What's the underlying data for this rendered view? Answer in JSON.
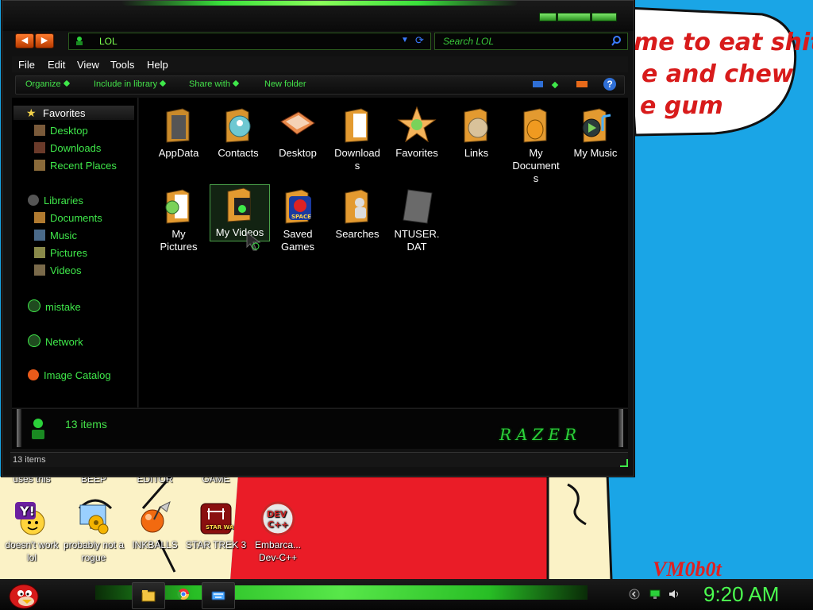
{
  "desktop": {
    "bubble_lines": [
      "me to eat shit",
      "e and chew",
      "e gum"
    ],
    "watermark": "VM0b0t",
    "cut_labels": [
      "uses this",
      "BEEP",
      "EDITOR",
      "GAME"
    ],
    "icons": [
      {
        "label": "doesn't work lol",
        "icon": "yahoo-messenger-icon"
      },
      {
        "label": "probably not a rogue",
        "icon": "gears-monitor-icon"
      },
      {
        "label": "INKBALLS",
        "icon": "inkball-icon"
      },
      {
        "label": "STAR TREK 3",
        "icon": "star-wars-icon"
      },
      {
        "label": "Embarca... Dev-C++",
        "icon": "dev-cpp-icon"
      }
    ]
  },
  "window": {
    "address": "LOL",
    "search_placeholder": "Search LOL",
    "menu": [
      "File",
      "Edit",
      "View",
      "Tools",
      "Help"
    ],
    "commands": [
      "Organize",
      "Include in library",
      "Share with",
      "New folder"
    ],
    "nav": {
      "favorites_header": "Favorites",
      "favorites": [
        "Desktop",
        "Downloads",
        "Recent Places"
      ],
      "libraries_header": "Libraries",
      "libraries": [
        "Documents",
        "Music",
        "Pictures",
        "Videos"
      ],
      "mistake": "mistake",
      "network": "Network",
      "image_catalog": "Image Catalog"
    },
    "items": [
      {
        "label": "AppData",
        "icon": "appdata-folder-icon"
      },
      {
        "label": "Contacts",
        "icon": "contacts-folder-icon"
      },
      {
        "label": "Desktop",
        "icon": "desktop-folder-icon"
      },
      {
        "label": "Downloads",
        "label_display": "Download\ns",
        "icon": "downloads-folder-icon"
      },
      {
        "label": "Favorites",
        "icon": "favorites-folder-icon"
      },
      {
        "label": "Links",
        "icon": "links-folder-icon"
      },
      {
        "label": "My Documents",
        "label_display": "My\nDocument\ns",
        "icon": "documents-folder-icon"
      },
      {
        "label": "My Music",
        "icon": "music-folder-icon"
      },
      {
        "label": "My Pictures",
        "label_display": "My\nPictures",
        "icon": "pictures-folder-icon"
      },
      {
        "label": "My Videos",
        "icon": "videos-folder-icon",
        "selected": true
      },
      {
        "label": "Saved Games",
        "label_display": "Saved\nGames",
        "icon": "saved-games-folder-icon"
      },
      {
        "label": "Searches",
        "icon": "searches-folder-icon"
      },
      {
        "label": "NTUSER.DAT",
        "label_display": "NTUSER.\nDAT",
        "icon": "dat-file-icon"
      }
    ],
    "details_count": "13 items",
    "brand": "RAZER",
    "status": "13 items"
  },
  "taskbar": {
    "clock": "9:20 AM"
  },
  "colors": {
    "accent_green": "#44e24a",
    "desktop_blue": "#1aa5e6",
    "bubble_red": "#d81b1b"
  }
}
